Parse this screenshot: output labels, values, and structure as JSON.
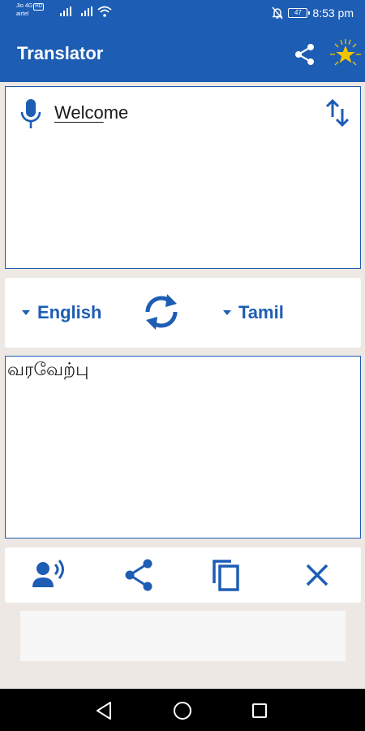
{
  "status_bar": {
    "carrier_line1": "Jio 4G",
    "carrier_badge": "HD",
    "carrier_line2": "airtel",
    "battery": "47",
    "time": "8:53 pm"
  },
  "app_bar": {
    "title": "Translator",
    "share_icon": "share-icon",
    "rate_icon": "star-icon"
  },
  "input": {
    "text_underlined": "Welco",
    "text_rest": "me",
    "mic_icon": "mic-icon",
    "swap_icon": "swap-vertical-icon"
  },
  "languages": {
    "source": "English",
    "target": "Tamil",
    "swap_icon": "sync-icon"
  },
  "output": {
    "text": "வரவேற்பு"
  },
  "actions": {
    "speak_icon": "speaker-icon",
    "share_icon": "share-icon",
    "copy_icon": "copy-icon",
    "clear_icon": "close-icon"
  },
  "colors": {
    "primary": "#1d5db4",
    "background": "#ede8e3",
    "star": "#f5c400"
  }
}
